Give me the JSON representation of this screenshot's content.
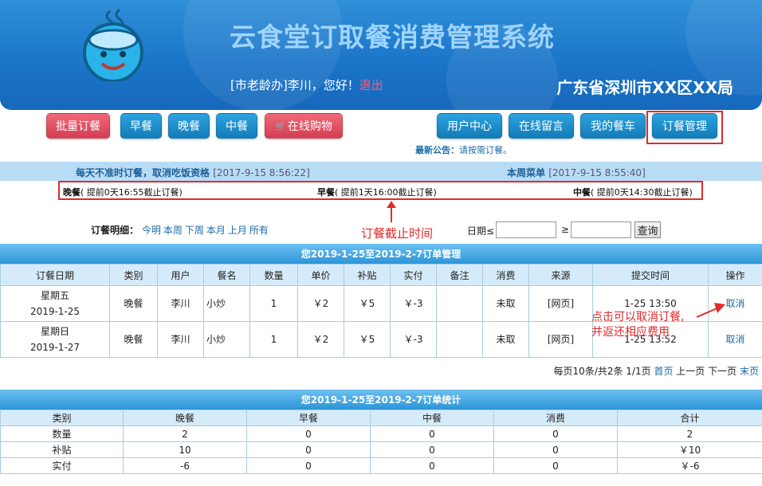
{
  "header": {
    "system_title": "云食堂订取餐消费管理系统",
    "greeting_prefix": "[市老龄办]李川，您好！",
    "logout": "退出",
    "org_name": "广东省深圳市XX区XX局"
  },
  "nav": {
    "left": [
      "批量订餐",
      "早餐",
      "晚餐",
      "中餐",
      "在线购物"
    ],
    "right": [
      "用户中心",
      "在线留言",
      "我的餐车",
      "订餐管理"
    ]
  },
  "notice": {
    "label": "最新公告：",
    "text": "请按需订餐。"
  },
  "info": {
    "left_label": "每天不准时订餐，取消吃饭资格",
    "left_time": "[2017-9-15 8:56:22]",
    "right_label": "本周菜单",
    "right_time": "[2017-9-15 8:55:40]"
  },
  "deadlines": [
    {
      "meal": "晚餐",
      "text": "( 提前0天16:55截止订餐)"
    },
    {
      "meal": "早餐",
      "text": "( 提前1天16:00截止订餐)"
    },
    {
      "meal": "中餐",
      "text": "( 提前0天14:30截止订餐)"
    }
  ],
  "annotations": {
    "deadline_note": "订餐截止时间",
    "cancel_note_1": "点击可以取消订餐,",
    "cancel_note_2": "并返还相应费用"
  },
  "filter": {
    "label": "订餐明细：",
    "links": [
      "今明",
      "本周",
      "下周",
      "本月",
      "上月",
      "所有"
    ],
    "date_label": "日期≤",
    "ge": "≥",
    "query": "查询"
  },
  "orders": {
    "title": "您2019-1-25至2019-2-7订单管理",
    "headers": [
      "订餐日期",
      "类别",
      "用户",
      "餐名",
      "数量",
      "单价",
      "补贴",
      "实付",
      "备注",
      "消费",
      "来源",
      "提交时间",
      "操作"
    ],
    "rows": [
      {
        "weekday": "星期五",
        "date": "2019-1-25",
        "type": "晚餐",
        "user": "李川",
        "dish": "小炒",
        "qty": "1",
        "price": "￥2",
        "subsidy": "￥5",
        "paid": "￥-3",
        "remark": "",
        "consume": "未取",
        "source": "[网页]",
        "time": "1-25 13:50",
        "action": "取消"
      },
      {
        "weekday": "星期日",
        "date": "2019-1-27",
        "type": "晚餐",
        "user": "李川",
        "dish": "小炒",
        "qty": "1",
        "price": "￥2",
        "subsidy": "￥5",
        "paid": "￥-3",
        "remark": "",
        "consume": "未取",
        "source": "[网页]",
        "time": "1-25 13:52",
        "action": "取消"
      }
    ],
    "pager": {
      "info": "每页10条/共2条 1/1页",
      "first": "首页",
      "prev": "上一页",
      "next": "下一页",
      "last": "末页"
    }
  },
  "stats": {
    "title": "您2019-1-25至2019-2-7订单统计",
    "headers": [
      "类别",
      "晚餐",
      "早餐",
      "中餐",
      "消费",
      "合计"
    ],
    "rows": [
      [
        "数量",
        "2",
        "0",
        "0",
        "0",
        "2"
      ],
      [
        "补贴",
        "10",
        "0",
        "0",
        "0",
        "￥10"
      ],
      [
        "实付",
        "-6",
        "0",
        "0",
        "0",
        "￥-6"
      ]
    ]
  },
  "colors": {
    "header_blue": "#1a74c8",
    "accent_red": "#e02b2b",
    "link_blue": "#1a6aa8"
  }
}
